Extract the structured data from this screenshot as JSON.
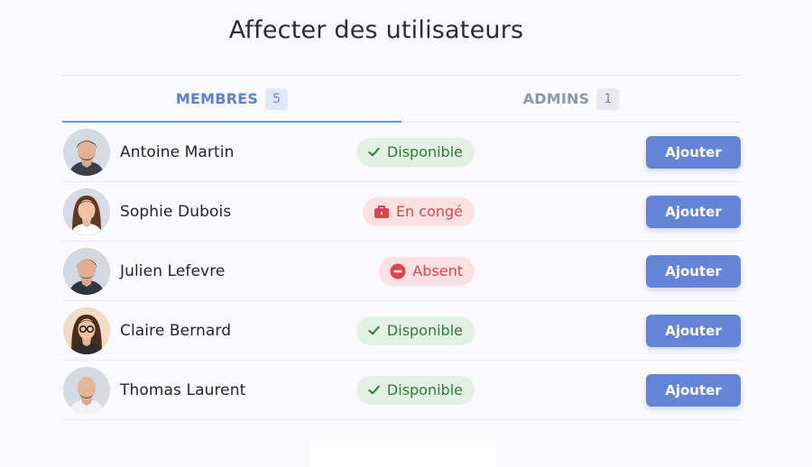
{
  "page": {
    "title": "Affecter des utilisateurs"
  },
  "tabs": [
    {
      "label": "MEMBRES",
      "count": "5",
      "active": true
    },
    {
      "label": "ADMINS",
      "count": "1",
      "active": false
    }
  ],
  "users": [
    {
      "name": "Antoine Martin",
      "status": "Disponible",
      "status_kind": "available",
      "status_icon": "check-icon",
      "action": "Ajouter"
    },
    {
      "name": "Sophie Dubois",
      "status": "En congé",
      "status_kind": "leave",
      "status_icon": "briefcase-icon",
      "action": "Ajouter"
    },
    {
      "name": "Julien Lefevre",
      "status": "Absent",
      "status_kind": "absent",
      "status_icon": "minus-circle-icon",
      "action": "Ajouter"
    },
    {
      "name": "Claire Bernard",
      "status": "Disponible",
      "status_kind": "available",
      "status_icon": "check-icon",
      "action": "Ajouter"
    },
    {
      "name": "Thomas Laurent",
      "status": "Disponible",
      "status_kind": "available",
      "status_icon": "check-icon",
      "action": "Ajouter"
    }
  ],
  "colors": {
    "accent": "#6584d6",
    "available_bg": "#e3f1e4",
    "available_text": "#2f7d3b",
    "warn_bg": "#fbe1e1",
    "warn_text": "#d9464b"
  }
}
